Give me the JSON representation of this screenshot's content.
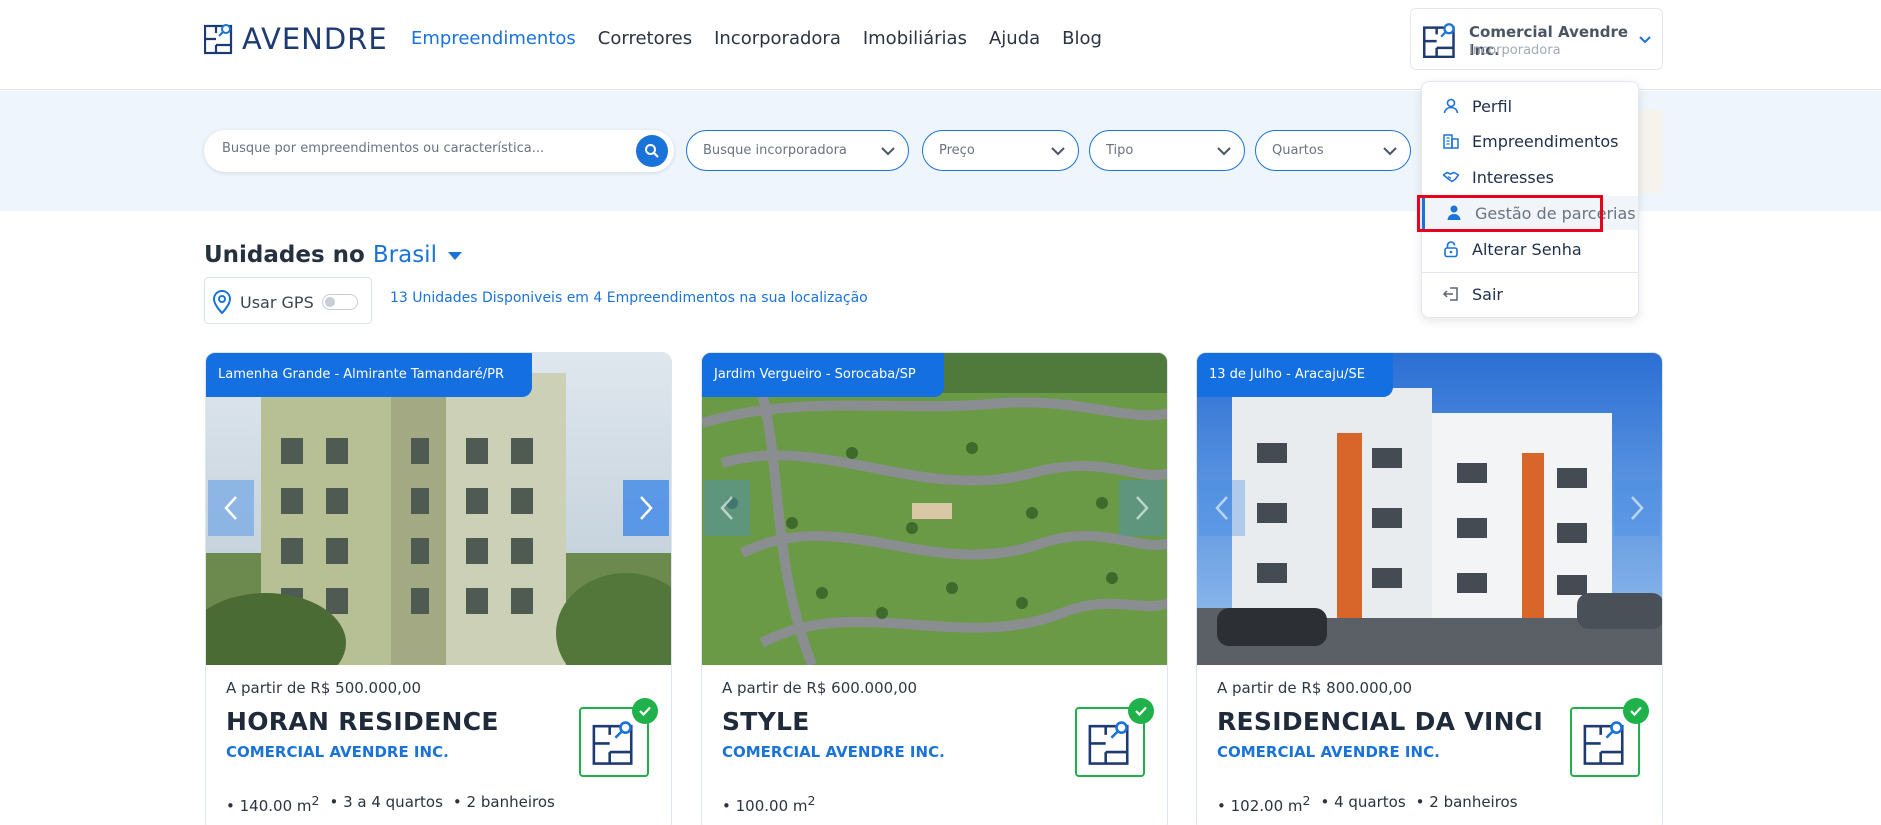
{
  "brand": {
    "name": "AVENDRE",
    "accent": "#1a73d9"
  },
  "nav": [
    {
      "label": "Empreendimentos",
      "active": true
    },
    {
      "label": "Corretores"
    },
    {
      "label": "Incorporadora"
    },
    {
      "label": "Imobiliárias"
    },
    {
      "label": "Ajuda"
    },
    {
      "label": "Blog"
    }
  ],
  "account": {
    "name": "Comercial Avendre Inc.",
    "role": "Incorporadora"
  },
  "search": {
    "placeholder": "Busque por empreendimentos ou característica..."
  },
  "filters": [
    {
      "label": "Busque incorporadora"
    },
    {
      "label": "Preço"
    },
    {
      "label": "Tipo"
    },
    {
      "label": "Quartos"
    }
  ],
  "section": {
    "title": "Unidades no",
    "location": "Brasil"
  },
  "gps": {
    "label": "Usar GPS",
    "enabled": false
  },
  "availability": "13 Unidades Disponiveis em 4 Empreendimentos na sua localização",
  "cards": [
    {
      "location": "Lamenha Grande - Almirante Tamandaré/PR",
      "price": "A partir de R$ 500.000,00",
      "name": "HORAN RESIDENCE",
      "company": "COMERCIAL AVENDRE INC.",
      "area": "140.00 m",
      "area_unit_sup": "2",
      "rooms": "3 a 4 quartos",
      "baths": "2 banheiros"
    },
    {
      "location": "Jardim Vergueiro - Sorocaba/SP",
      "price": "A partir de R$ 600.000,00",
      "name": "STYLE",
      "company": "COMERCIAL AVENDRE INC.",
      "area": "100.00 m",
      "area_unit_sup": "2"
    },
    {
      "location": "13 de Julho - Aracaju/SE",
      "price": "A partir de R$ 800.000,00",
      "name": "RESIDENCIAL DA VINCI",
      "company": "COMERCIAL AVENDRE INC.",
      "area": "102.00 m",
      "area_unit_sup": "2",
      "rooms": "4 quartos",
      "baths": "2 banheiros"
    }
  ],
  "menu": {
    "items": [
      {
        "label": "Perfil",
        "icon": "user-icon"
      },
      {
        "label": "Empreendimentos",
        "icon": "building-icon"
      },
      {
        "label": "Interesses",
        "icon": "handshake-icon"
      },
      {
        "label": "Gestão de parcerias",
        "icon": "partners-icon",
        "selected": true
      },
      {
        "label": "Alterar Senha",
        "icon": "lock-icon"
      },
      {
        "label": "Sair",
        "icon": "logout-icon"
      }
    ]
  }
}
